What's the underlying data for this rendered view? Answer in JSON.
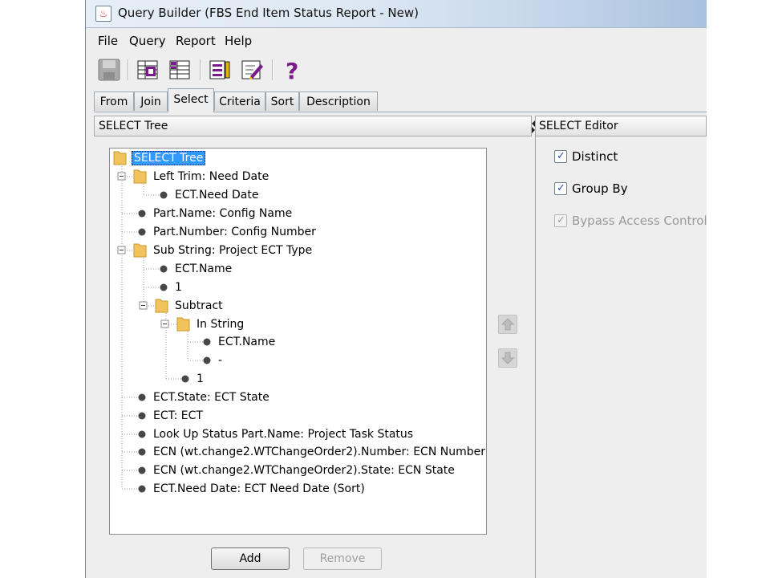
{
  "window": {
    "title": "Query Builder (FBS End Item Status Report - New)"
  },
  "menu": [
    "File",
    "Query",
    "Report",
    "Help"
  ],
  "toolbar": {
    "icons": [
      "save-icon",
      "add-table-icon",
      "table-properties-icon",
      "report-icon",
      "edit-icon",
      "help-icon"
    ],
    "help_glyph": "?"
  },
  "tabs": [
    "From",
    "Join",
    "Select",
    "Criteria",
    "Sort",
    "Description"
  ],
  "active_tab": "Select",
  "left_panel": {
    "header": "SELECT Tree"
  },
  "right_panel": {
    "header": "SELECT Editor"
  },
  "tree": {
    "root": "SELECT Tree",
    "nodes": [
      "Left Trim: Need Date",
      "ECT.Need Date",
      "Part.Name: Config Name",
      "Part.Number: Config Number",
      "Sub String: Project ECT Type",
      "ECT.Name",
      "1",
      "Subtract",
      "In String",
      "ECT.Name",
      "-",
      "1",
      "ECT.State: ECT State",
      "ECT: ECT",
      "Look Up Status Part.Name: Project Task Status",
      "ECN (wt.change2.WTChangeOrder2).Number: ECN Number",
      "ECN (wt.change2.WTChangeOrder2).State: ECN State",
      "ECT.Need Date: ECT Need Date (Sort)"
    ]
  },
  "editor": {
    "distinct": {
      "label": "Distinct",
      "checked": true
    },
    "group_by": {
      "label": "Group By",
      "checked": true
    },
    "bypass": {
      "label": "Bypass Access Control",
      "checked": true,
      "disabled": true
    },
    "check_glyph": "✓"
  },
  "buttons": {
    "add": "Add",
    "remove": "Remove"
  },
  "colors": {
    "selection": "#3399ff",
    "folder": "#f2c25c",
    "accent": "#1f4c99"
  }
}
